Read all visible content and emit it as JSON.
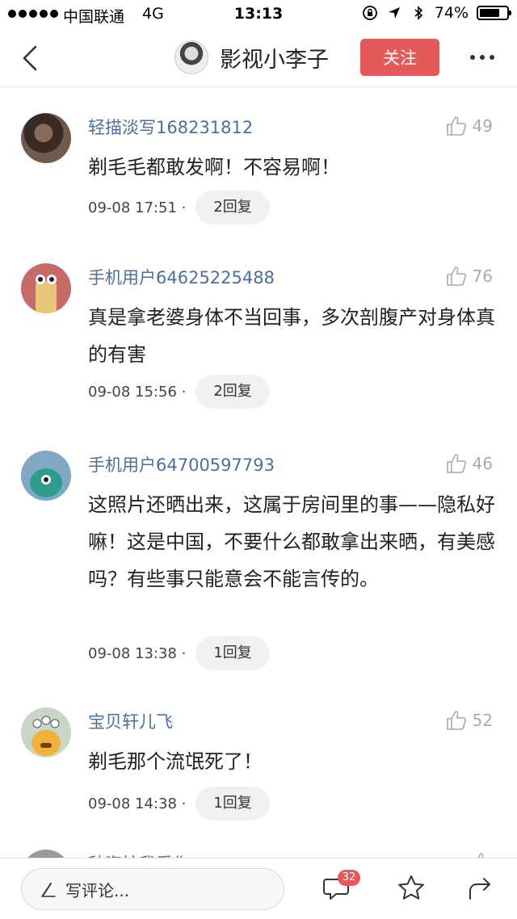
{
  "status_bar": {
    "carrier": "中国联通",
    "network": "4G",
    "time": "13:13",
    "battery": "74%",
    "battery_level": 0.74
  },
  "nav": {
    "title": "影视小李子",
    "follow_label": "关注"
  },
  "comments": [
    {
      "username": "轻描淡写168231812",
      "likes": "49",
      "text": "剃毛毛都敢发啊！不容易啊！",
      "timestamp": "09-08 17:51 ·",
      "replies": "2回复"
    },
    {
      "username": "手机用户64625225488",
      "likes": "76",
      "text": "真是拿老婆身体不当回事，多次剖腹产对身体真的有害",
      "timestamp": "09-08 15:56 ·",
      "replies": "2回复"
    },
    {
      "username": "手机用户64700597793",
      "likes": "46",
      "text": "这照片还晒出来，这属于房间里的事——隐私好嘛！这是中国，不要什么都敢拿出来晒，有美感吗？有些事只能意会不能言传的。",
      "timestamp": "09-08 13:38 ·",
      "replies": "1回复"
    },
    {
      "username": "宝贝轩儿飞",
      "likes": "52",
      "text": "剃毛那个流氓死了！",
      "timestamp": "09-08 14:38 ·",
      "replies": "1回复"
    },
    {
      "username": "秋姿桔我爱你",
      "likes": "",
      "text": "",
      "timestamp": "",
      "replies": ""
    }
  ],
  "bottom_bar": {
    "input_placeholder": "写评论...",
    "comment_count": "32"
  },
  "colors": {
    "accent": "#e45a5a",
    "username": "#4d6f9b"
  }
}
